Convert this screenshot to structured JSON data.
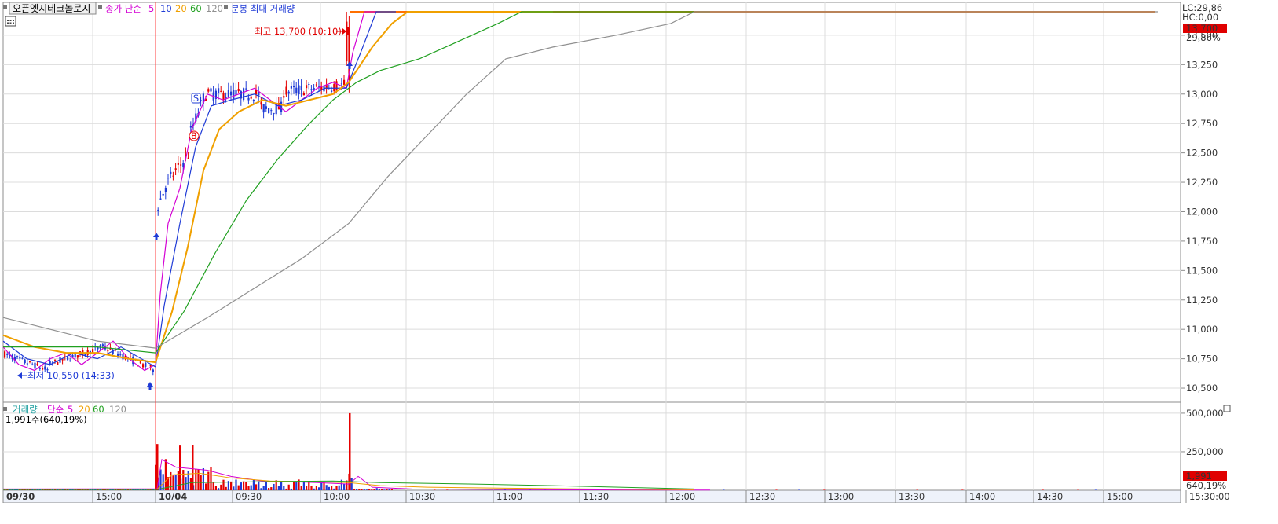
{
  "header": {
    "stock_name": "오픈엣지테크놀로지",
    "ma_label": "종가 단순",
    "ma_periods": [
      "5",
      "10",
      "20",
      "60",
      "120"
    ],
    "candle_label": "분봉 최대 거래량",
    "lc": "LC:29,86",
    "hc": "HC:0,00"
  },
  "volume_header": {
    "label": "거래량",
    "ma_label": "단순",
    "ma_periods": [
      "5",
      "20",
      "60",
      "120"
    ],
    "value": "1,991주(640,19%)"
  },
  "annotations": {
    "high": "최고 13,700 (10:10)",
    "low": "최저 10,550 (14:33)",
    "buy_marker": "B",
    "sell_marker": "S"
  },
  "right_tags": {
    "price": "13,700",
    "price_pct": "29,86%",
    "volume": "1,991",
    "volume_pct": "640,19%"
  },
  "colors": {
    "up": "#e60000",
    "down": "#1f3bd6",
    "ma5": "#d400d4",
    "ma10": "#1f3bd6",
    "ma20": "#f0a000",
    "ma60": "#20a020",
    "ma120": "#909090",
    "limit_line": "#ff7000",
    "price_tag": "#e00000"
  },
  "chart_data": [
    {
      "type": "candlestick",
      "title": "",
      "y_ticks": [
        10500,
        10750,
        11000,
        11250,
        11500,
        11750,
        12000,
        12250,
        12500,
        12750,
        13000,
        13250,
        13500
      ],
      "y_tick_labels": [
        "10,500",
        "10,750",
        "11,000",
        "11,250",
        "11,500",
        "11,750",
        "12,000",
        "12,250",
        "12,500",
        "12,750",
        "13,000",
        "13,250",
        "13,500"
      ],
      "ylim": [
        10380,
        13780
      ],
      "x_tick_labels": [
        "09/30",
        "15:00",
        "10/04",
        "09:30",
        "10:00",
        "10:30",
        "11:00",
        "11:30",
        "12:00",
        "12:30",
        "13:00",
        "13:30",
        "14:00",
        "14:30",
        "15:00",
        "15:30:00"
      ],
      "high": {
        "value": 13700,
        "time": "10:10"
      },
      "low": {
        "value": 10550,
        "time": "14:33"
      },
      "ma_series": [
        {
          "name": "5",
          "points": [
            [
              0,
              10850
            ],
            [
              20,
              10700
            ],
            [
              40,
              10650
            ],
            [
              60,
              10750
            ],
            [
              80,
              10800
            ],
            [
              100,
              10700
            ],
            [
              120,
              10800
            ],
            [
              140,
              10900
            ],
            [
              160,
              10750
            ],
            [
              180,
              10650
            ],
            [
              194,
              10700
            ],
            [
              200,
              11300
            ],
            [
              210,
              11900
            ],
            [
              225,
              12200
            ],
            [
              240,
              12700
            ],
            [
              260,
              13000
            ],
            [
              280,
              12950
            ],
            [
              300,
              13000
            ],
            [
              320,
              13050
            ],
            [
              340,
              12950
            ],
            [
              360,
              12850
            ],
            [
              380,
              12950
            ],
            [
              400,
              13050
            ],
            [
              420,
              13100
            ],
            [
              437,
              13050
            ],
            [
              445,
              13350
            ],
            [
              460,
              13700
            ],
            [
              480,
              13700
            ]
          ]
        },
        {
          "name": "10",
          "points": [
            [
              0,
              10900
            ],
            [
              30,
              10750
            ],
            [
              60,
              10700
            ],
            [
              90,
              10800
            ],
            [
              120,
              10750
            ],
            [
              150,
              10850
            ],
            [
              194,
              10680
            ],
            [
              205,
              11200
            ],
            [
              225,
              11900
            ],
            [
              245,
              12550
            ],
            [
              265,
              12900
            ],
            [
              290,
              12950
            ],
            [
              320,
              13000
            ],
            [
              350,
              12900
            ],
            [
              380,
              12950
            ],
            [
              410,
              13050
            ],
            [
              437,
              13050
            ],
            [
              455,
              13350
            ],
            [
              475,
              13700
            ],
            [
              500,
              13700
            ]
          ]
        },
        {
          "name": "20",
          "points": [
            [
              0,
              10950
            ],
            [
              40,
              10850
            ],
            [
              80,
              10800
            ],
            [
              120,
              10800
            ],
            [
              160,
              10750
            ],
            [
              194,
              10720
            ],
            [
              215,
              11150
            ],
            [
              235,
              11700
            ],
            [
              255,
              12350
            ],
            [
              275,
              12700
            ],
            [
              300,
              12850
            ],
            [
              330,
              12950
            ],
            [
              360,
              12900
            ],
            [
              390,
              12950
            ],
            [
              420,
              13000
            ],
            [
              440,
              13100
            ],
            [
              470,
              13400
            ],
            [
              495,
              13600
            ],
            [
              515,
              13700
            ],
            [
              700,
              13700
            ]
          ]
        },
        {
          "name": "60",
          "points": [
            [
              0,
              10850
            ],
            [
              60,
              10850
            ],
            [
              120,
              10850
            ],
            [
              194,
              10800
            ],
            [
              230,
              11150
            ],
            [
              270,
              11650
            ],
            [
              310,
              12100
            ],
            [
              350,
              12450
            ],
            [
              390,
              12750
            ],
            [
              420,
              12950
            ],
            [
              450,
              13100
            ],
            [
              480,
              13200
            ],
            [
              530,
              13300
            ],
            [
              580,
              13450
            ],
            [
              630,
              13600
            ],
            [
              660,
              13700
            ],
            [
              900,
              13700
            ]
          ]
        },
        {
          "name": "120",
          "points": [
            [
              0,
              11100
            ],
            [
              60,
              11000
            ],
            [
              120,
              10900
            ],
            [
              194,
              10840
            ],
            [
              260,
              11100
            ],
            [
              320,
              11350
            ],
            [
              380,
              11600
            ],
            [
              440,
              11900
            ],
            [
              490,
              12300
            ],
            [
              540,
              12650
            ],
            [
              590,
              13000
            ],
            [
              640,
              13300
            ],
            [
              700,
              13400
            ],
            [
              780,
              13500
            ],
            [
              850,
              13600
            ],
            [
              880,
              13700
            ],
            [
              1470,
              13700
            ]
          ]
        }
      ]
    },
    {
      "type": "bar",
      "title": "",
      "y_ticks": [
        250000,
        500000
      ],
      "y_tick_labels": [
        "250,000",
        "500,000"
      ],
      "ylim": [
        0,
        520000
      ],
      "last_value": 1991,
      "last_pct": "640,19%"
    }
  ]
}
